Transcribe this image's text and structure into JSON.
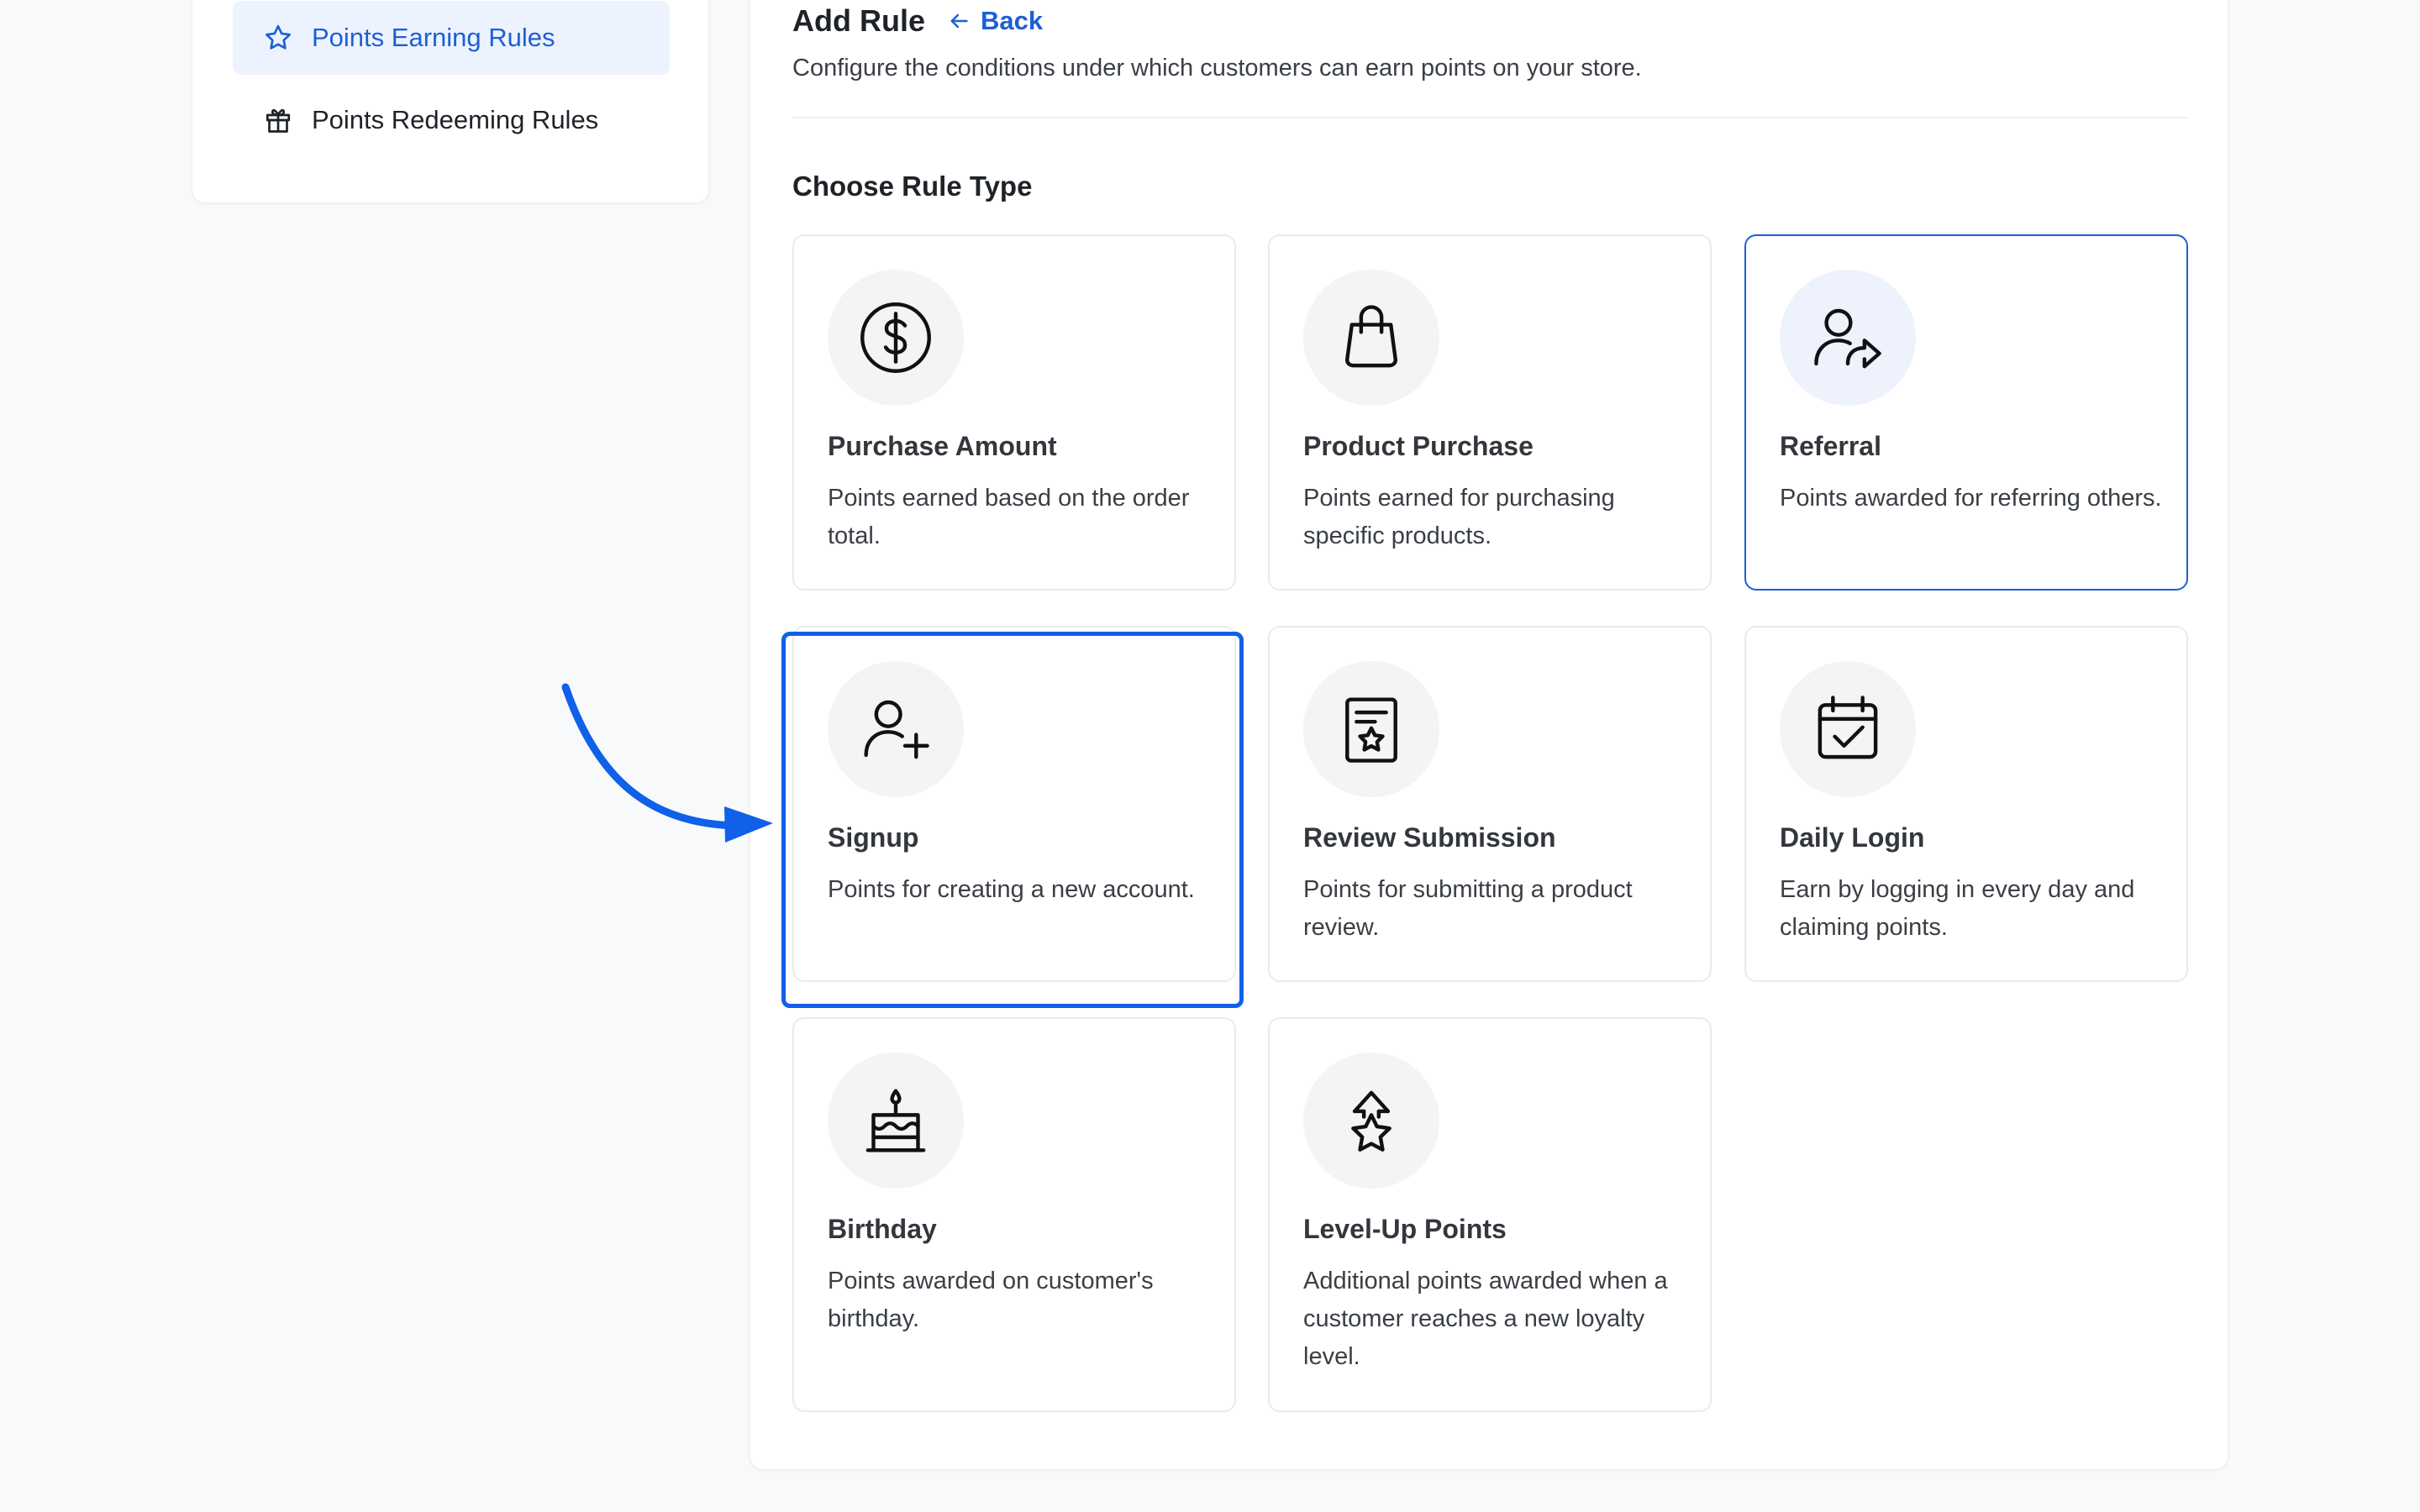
{
  "sidebar": {
    "items": [
      {
        "label": "Points Earning Rules",
        "icon": "star-icon",
        "active": true
      },
      {
        "label": "Points Redeeming Rules",
        "icon": "gift-icon",
        "active": false
      }
    ]
  },
  "header": {
    "title": "Add Rule",
    "back_label": "Back",
    "description": "Configure the conditions under which customers can earn points on your store."
  },
  "section": {
    "title": "Choose Rule Type"
  },
  "rule_types": [
    {
      "title": "Purchase Amount",
      "desc": "Points earned based on the order total.",
      "icon": "dollar-circle-icon"
    },
    {
      "title": "Product Purchase",
      "desc": "Points earned for purchasing specific products.",
      "icon": "shopping-bag-icon"
    },
    {
      "title": "Referral",
      "desc": "Points awarded for referring others.",
      "icon": "user-share-icon",
      "selected": true
    },
    {
      "title": "Signup",
      "desc": "Points for creating a new account.",
      "icon": "user-plus-icon",
      "highlighted": true
    },
    {
      "title": "Review Submission",
      "desc": "Points for submitting a product review.",
      "icon": "review-star-icon"
    },
    {
      "title": "Daily Login",
      "desc": "Earn by logging in every day and claiming points.",
      "icon": "calendar-check-icon"
    },
    {
      "title": "Birthday",
      "desc": "Points awarded on customer's birthday.",
      "icon": "birthday-cake-icon"
    },
    {
      "title": "Level-Up Points",
      "desc": "Additional points awarded when a customer reaches a new loyalty level.",
      "icon": "level-up-star-icon"
    }
  ],
  "colors": {
    "accent": "#1d5fd6",
    "annotation": "#1060e8",
    "active_bg": "#edf3fe",
    "card_border": "#e8ebf0",
    "icon_bg": "#f3f4f6"
  }
}
